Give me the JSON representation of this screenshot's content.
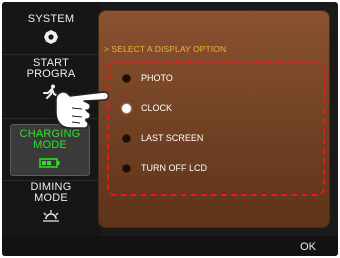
{
  "sidebar": {
    "items": [
      {
        "label": "SYSTEM",
        "icon": "gear-icon"
      },
      {
        "label": "START\nPROGRA",
        "icon": "runner-icon"
      },
      {
        "label": "CHARGING\nMODE",
        "icon": "battery-icon"
      },
      {
        "label": "DIMING\nMODE",
        "icon": "sun-dim-icon"
      }
    ]
  },
  "panel": {
    "prompt": "> SELECT A DISPLAY OPTION",
    "options": [
      {
        "label": "PHOTO",
        "selected": false
      },
      {
        "label": "CLOCK",
        "selected": true
      },
      {
        "label": "LAST SCREEN",
        "selected": false
      },
      {
        "label": "TURN OFF LCD",
        "selected": false
      }
    ]
  },
  "footer": {
    "ok_label": "OK"
  },
  "colors": {
    "panel": "#7a4628",
    "accent_text": "#f2b233",
    "highlight_box": "#e01b1b",
    "active_mode": "#30e030"
  }
}
